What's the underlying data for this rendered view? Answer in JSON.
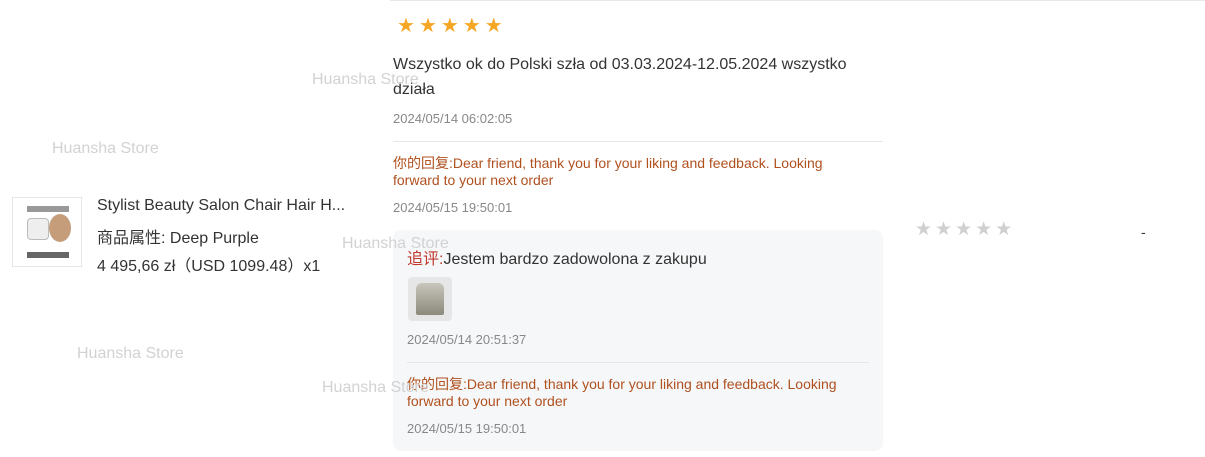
{
  "watermark": "Huansha Store",
  "product": {
    "name": "Stylist Beauty Salon Chair Hair H...",
    "attr": "商品属性:  Deep Purple",
    "price": "4 495,66 zł（USD  1099.48）x1"
  },
  "review": {
    "rating": 5,
    "text": "Wszystko ok do Polski szła od 03.03.2024-12.05.2024 wszystko działa",
    "date": "2024/05/14 06:02:05",
    "reply_label": "你的回复:",
    "reply_text": "Dear friend, thank you for your liking and feedback. Looking forward to your next order",
    "reply_date": "2024/05/15 19:50:01"
  },
  "followup": {
    "label": "追评:",
    "text": "Jestem bardzo zadowolona z zakupu",
    "image": "review-photo",
    "date": "2024/05/14 20:51:37",
    "reply_label": "你的回复:",
    "reply_text": "Dear friend, thank you for your liking and feedback. Looking forward to your next order",
    "reply_date": "2024/05/15 19:50:01"
  },
  "seller_rating": {
    "rating": 0,
    "value": "-"
  },
  "colors": {
    "star_on": "#f5a623",
    "star_off": "#d0d0d0",
    "reply_text": "#b0501f",
    "followup_label": "#c0392b",
    "followup_bg": "#f6f7f9"
  }
}
